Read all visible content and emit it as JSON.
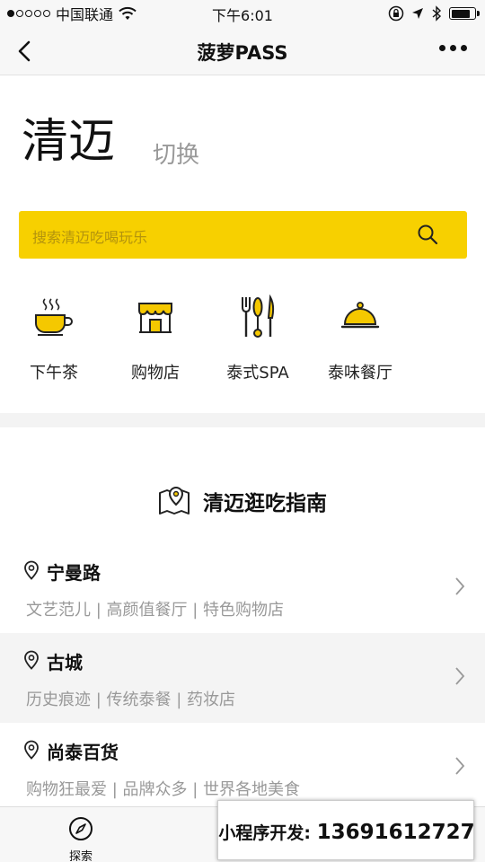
{
  "status_bar": {
    "carrier": "中国联通",
    "time": "下午6:01",
    "signal_strength": 1,
    "battery_level": 0.8
  },
  "nav": {
    "title": "菠萝PASS",
    "back_icon": "chevron-left-icon",
    "more_icon": "more-dots-icon"
  },
  "header": {
    "city": "清迈",
    "switch_label": "切换"
  },
  "search": {
    "placeholder": "搜索清迈吃喝玩乐",
    "icon": "search-icon"
  },
  "categories": [
    {
      "label": "下午茶",
      "icon": "teacup-icon"
    },
    {
      "label": "购物店",
      "icon": "shop-icon"
    },
    {
      "label": "泰式SPA",
      "icon": "spa-tools-icon"
    },
    {
      "label": "泰味餐厅",
      "icon": "food-cloche-icon"
    }
  ],
  "guide": {
    "title": "清迈逛吃指南",
    "icon": "map-pin-icon",
    "areas": [
      {
        "name": "宁曼路",
        "tags": "文艺范儿 | 高颜值餐厅 | 特色购物店"
      },
      {
        "name": "古城",
        "tags": "历史痕迹 | 传统泰餐 | 药妆店"
      },
      {
        "name": "尚泰百货",
        "tags": "购物狂最爱 | 品牌众多 | 世界各地美食"
      }
    ]
  },
  "tab_bar": {
    "tabs": [
      {
        "label": "探索",
        "icon": "compass-icon"
      }
    ]
  },
  "promo": {
    "label": "小程序开发:",
    "phone": "13691612727"
  },
  "colors": {
    "accent": "#f7d000",
    "icon_yellow": "#f5c800",
    "text_muted": "#999999"
  }
}
